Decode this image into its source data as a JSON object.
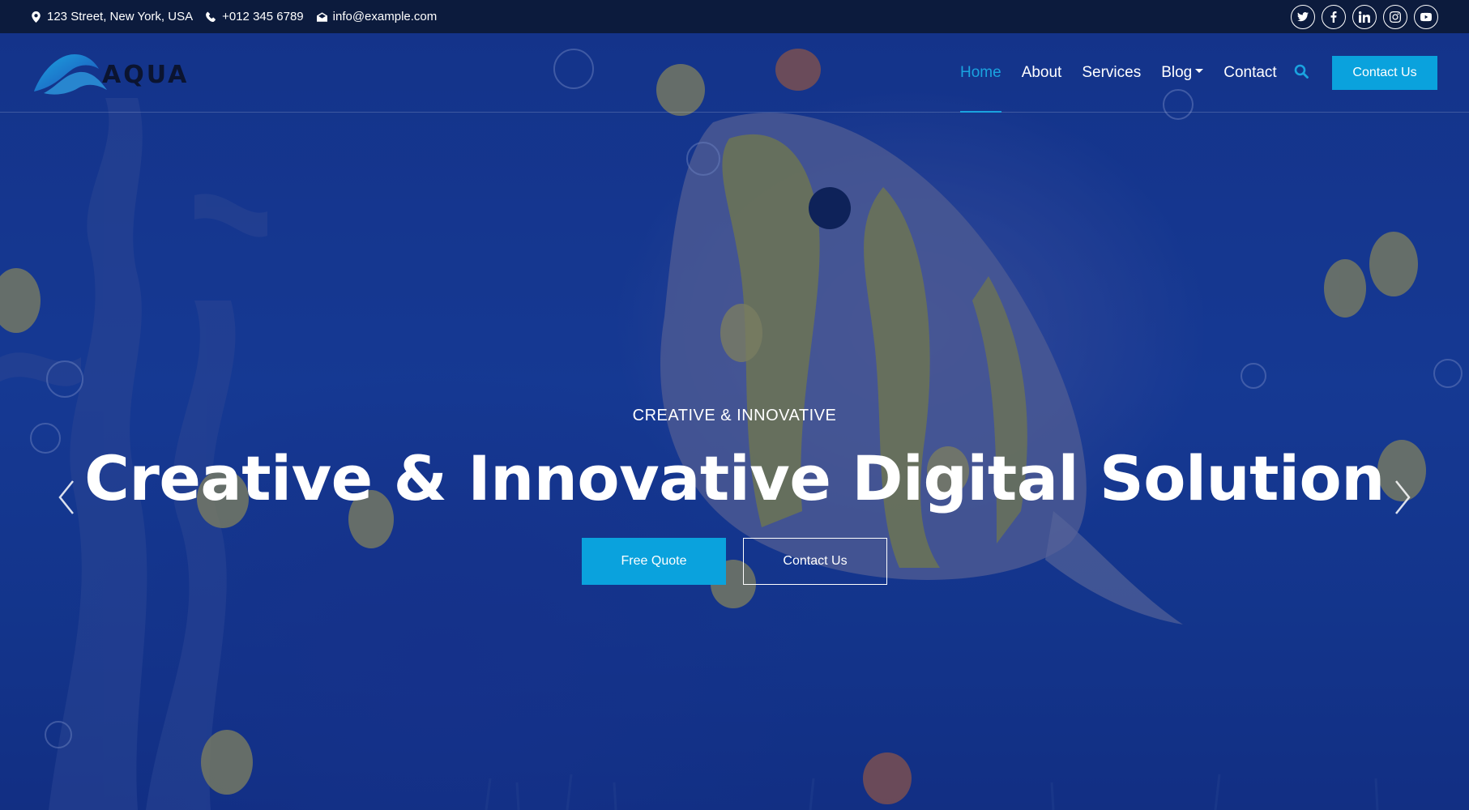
{
  "topbar": {
    "address": "123 Street, New York, USA",
    "phone": "+012 345 6789",
    "email": "info@example.com",
    "socials": [
      "twitter",
      "facebook",
      "linkedin",
      "instagram",
      "youtube"
    ]
  },
  "navbar": {
    "logo_text": "AQUA",
    "links": [
      {
        "label": "Home",
        "active": true
      },
      {
        "label": "About"
      },
      {
        "label": "Services"
      },
      {
        "label": "Blog",
        "dropdown": true
      },
      {
        "label": "Contact"
      }
    ],
    "search_icon": "search-icon",
    "cta_label": "Contact Us"
  },
  "hero": {
    "eyebrow": "CREATIVE & INNOVATIVE",
    "headline": "Creative & Innovative Digital Solution",
    "primary_button": "Free Quote",
    "secondary_button": "Contact Us",
    "prev_icon": "chevron-left-icon",
    "next_icon": "chevron-right-icon"
  },
  "colors": {
    "accent": "#0aa2dd",
    "topbar_bg": "#0c1b3d",
    "hero_bg": "#1d45a8"
  }
}
